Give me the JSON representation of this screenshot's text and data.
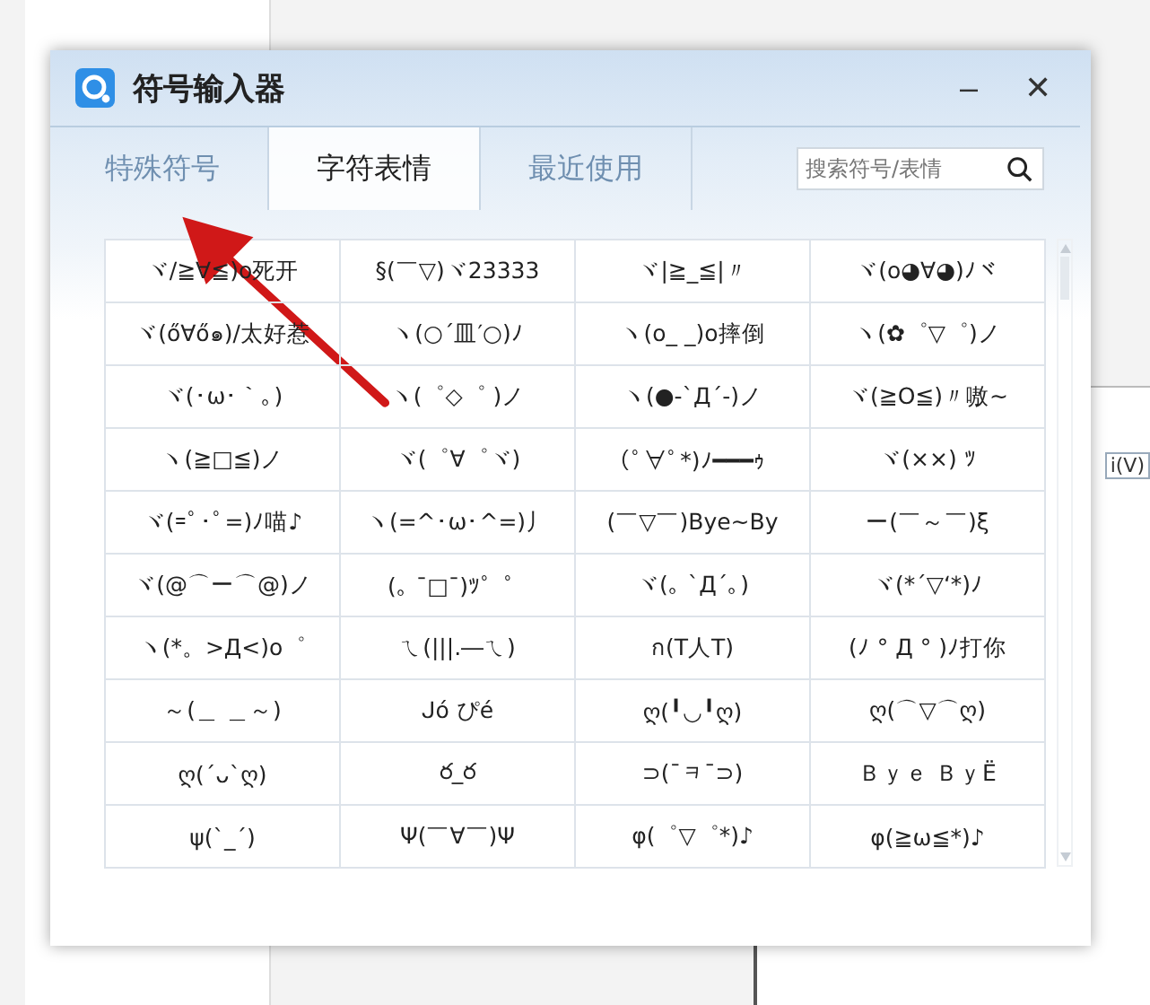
{
  "window": {
    "title": "符号输入器",
    "minimize": "–",
    "close": "✕"
  },
  "tabs": [
    {
      "label": "特殊符号",
      "selected": false
    },
    {
      "label": "字符表情",
      "selected": true
    },
    {
      "label": "最近使用",
      "selected": false
    }
  ],
  "search": {
    "placeholder": "搜索符号/表情"
  },
  "grid": {
    "rows": [
      [
        "ヾ/≧∀≦)o死开",
        "§(￣▽)ヾ23333",
        "ヾ|≧_≦|〃",
        "ヾ(o◕∀◕)ﾉヾ"
      ],
      [
        "ヾ(ő∀ő๑)/太好惹",
        "ヽ(○´皿′○)ﾉ",
        "ヽ(o_ _)o摔倒",
        "ヽ(✿゜▽゜)ノ"
      ],
      [
        "ヾ(･ω･｀｡)",
        "ヽ(゜◇゜ )ノ",
        "ヽ(●-`Д´-)ノ",
        "ヾ(≧O≦)〃嗷~"
      ],
      [
        "ヽ(≧□≦)ノ",
        "ヾ(゜∀゜ヾ)",
        "(ﾟ∀ﾟ*)ﾉ━━━ｩ",
        "ヾ(××) ﾂ"
      ],
      [
        "ヾ(=ﾟ･ﾟ=)ﾉ喵♪",
        "ヽ(=^･ω･^=)丿",
        "(￣▽￣)Bye~By",
        "ー(￣～￣)ξ"
      ],
      [
        "ヾ(@⌒ー⌒@)ノ",
        "(｡ ¯□¯)ﾂ゜゜",
        "ヾ(｡ `Д´｡)",
        "ヾ(*´▽‘*)ﾉ"
      ],
      [
        "ヽ(*。>Д<)o゜",
        "ㄟ(|||.―ㄟ)",
        "ก(T人T)",
        "(ﾉ ° Д ° )ﾉ打你"
      ],
      [
        "～(＿ ＿～)",
        "ᒍó ぴé",
        "ღ(╹◡╹ღ)",
        "ღ(⌒▽⌒ღ)"
      ],
      [
        "ღ(´ᴗ`ღ)",
        "ర_ర",
        "⊃(¯ᆿ¯⊃)",
        "Ｂｙｅ ＢｙË"
      ],
      [
        "ψ(ˋ_ˊ)",
        "Ψ(￣∀￣)Ψ",
        "φ(゜▽゜*)♪",
        "φ(≧ω≦*)♪"
      ]
    ]
  },
  "background": {
    "fragment": "i(V)"
  }
}
